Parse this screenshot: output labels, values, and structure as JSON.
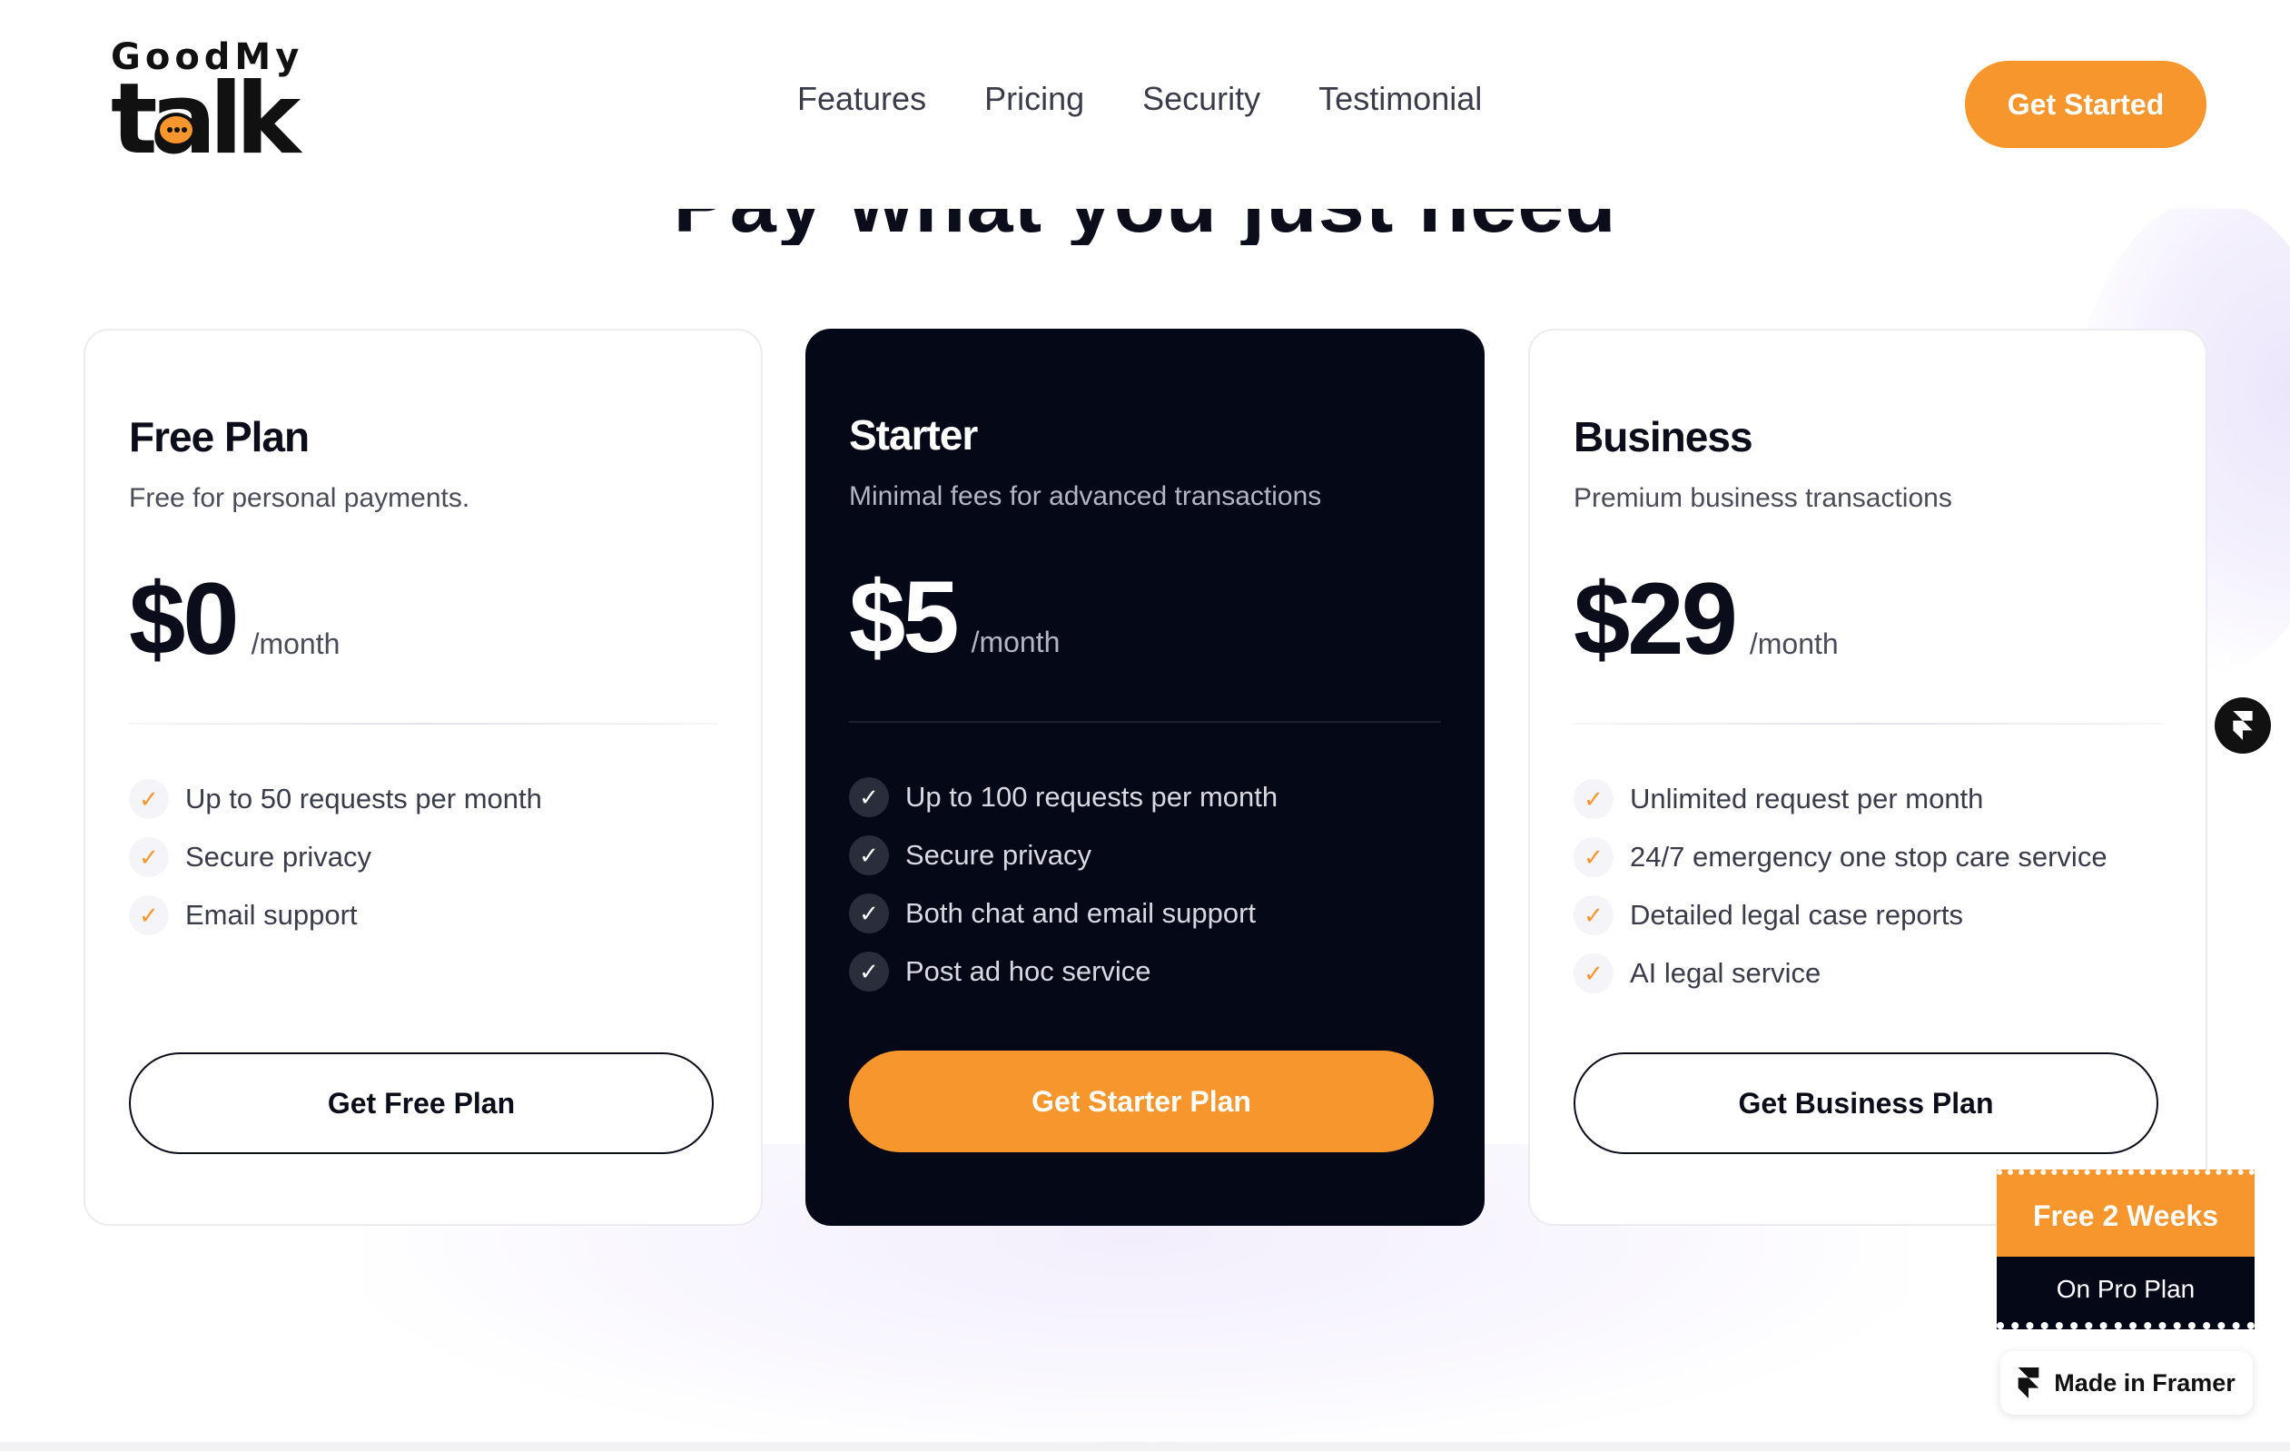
{
  "brand": {
    "logo_top": "GoodMy",
    "logo_bottom": "talk"
  },
  "nav": {
    "items": [
      {
        "label": "Features"
      },
      {
        "label": "Pricing"
      },
      {
        "label": "Security"
      },
      {
        "label": "Testimonial"
      }
    ],
    "cta_label": "Get Started"
  },
  "pricing": {
    "heading": "Pay what you just need",
    "plans": [
      {
        "title": "Free Plan",
        "subtitle": "Free for personal payments.",
        "price": "$0",
        "period": "/month",
        "features": [
          "Up to 50 requests per month",
          "Secure privacy",
          "Email support"
        ],
        "button": "Get Free Plan"
      },
      {
        "title": "Starter",
        "subtitle": "Minimal fees for advanced transactions",
        "price": "$5",
        "period": "/month",
        "features": [
          "Up to 100 requests per month",
          "Secure privacy",
          "Both chat and email support",
          "Post ad hoc service"
        ],
        "button": "Get Starter Plan"
      },
      {
        "title": "Business",
        "subtitle": "Premium business transactions",
        "price": "$29",
        "period": "/month",
        "features": [
          "Unlimited request per month",
          "24/7 emergency one stop care service",
          "Detailed legal case reports",
          "AI legal service"
        ],
        "button": "Get Business Plan"
      }
    ]
  },
  "promo": {
    "top": "Free 2 Weeks",
    "bottom": "On Pro Plan"
  },
  "badge": {
    "label": "Made in Framer"
  },
  "icons": {
    "check": "checkmark-icon",
    "framer": "framer-icon",
    "chat": "chat-bubble-icon"
  },
  "colors": {
    "accent": "#f7962d",
    "dark": "#050817",
    "text": "#0b0d1a"
  }
}
